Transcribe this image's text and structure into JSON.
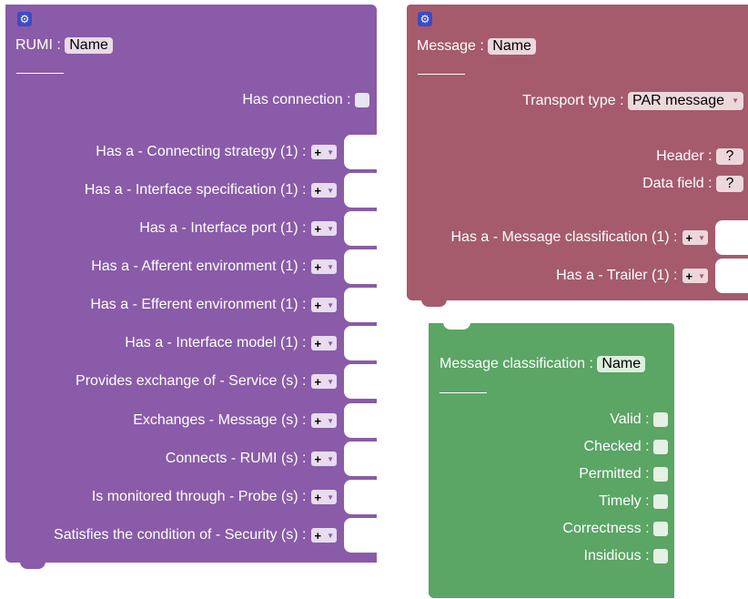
{
  "rumi": {
    "title": "RUMI :",
    "name": "Name",
    "has_connection": "Has connection :",
    "rows": [
      "Has a - Connecting strategy (1) :",
      "Has a - Interface specification (1) :",
      "Has a - Interface port (1) :",
      "Has a - Afferent environment (1) :",
      "Has a - Efferent environment (1) :",
      "Has a - Interface model (1) :",
      "Provides exchange of - Service (s) :",
      "Exchanges - Message (s) :",
      "Connects - RUMI (s) :",
      "Is monitored through - Probe (s) :",
      "Satisfies the condition of - Security (s) :"
    ],
    "mutator_label": "+"
  },
  "message": {
    "title": "Message :",
    "name": "Name",
    "transport_label": "Transport type :",
    "transport_value": "PAR message",
    "header_label": "Header :",
    "header_value": "?",
    "data_field_label": "Data field :",
    "data_field_value": "?",
    "rows": [
      "Has a - Message classification (1) :",
      "Has a - Trailer (1) :"
    ],
    "mutator_label": "+"
  },
  "classification": {
    "title": "Message classification :",
    "name": "Name",
    "checks": [
      "Valid :",
      "Checked :",
      "Permitted :",
      "Timely :",
      "Correctness :",
      "Insidious :"
    ]
  },
  "colors": {
    "rumi_block": "#8a5ba8",
    "message_block": "#a55b6c",
    "classification_block": "#5ba565"
  }
}
